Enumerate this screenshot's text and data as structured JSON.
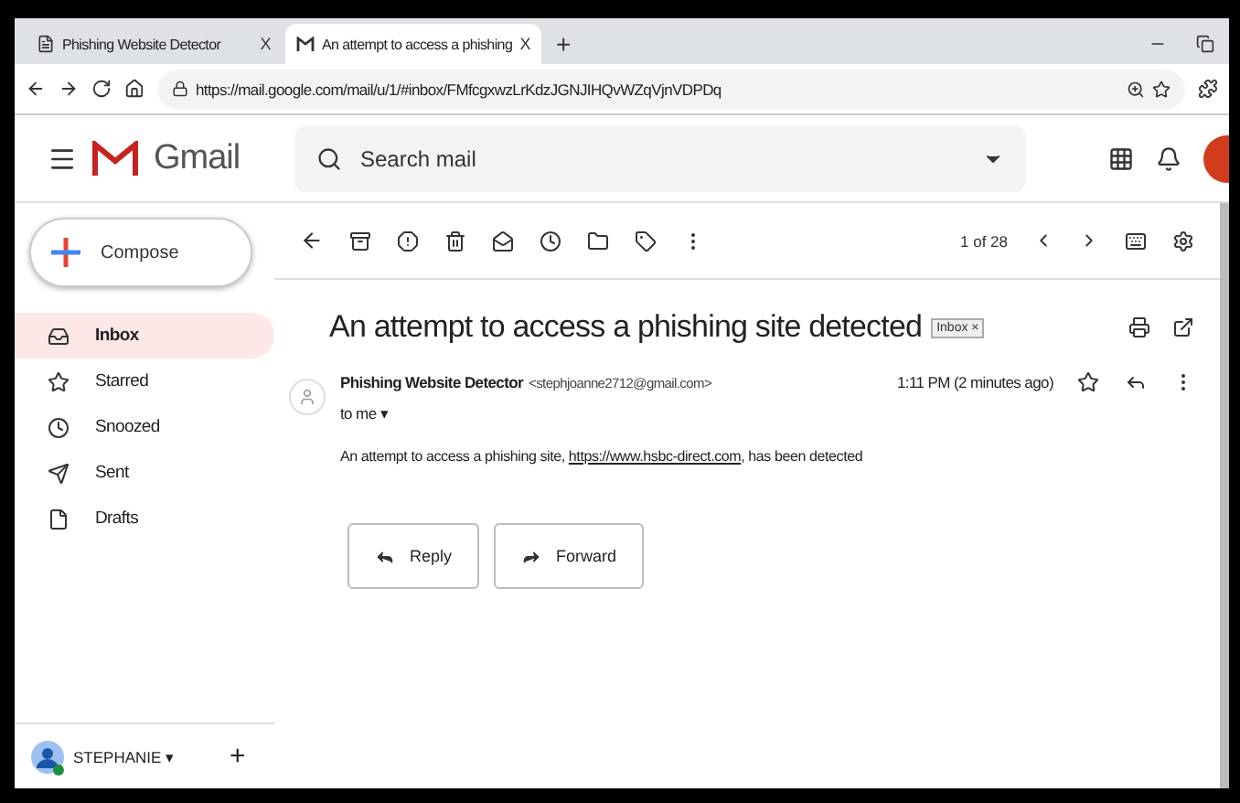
{
  "browser": {
    "tabs": [
      {
        "title": "Phishing Website Detector",
        "close": "X",
        "selected": false,
        "kind": "page"
      },
      {
        "title": "An attempt to access a phishing",
        "close": "X",
        "selected": true,
        "kind": "mail"
      }
    ],
    "new_tab": "+",
    "url": "https://mail.google.com/mail/u/1/#inbox/FMfcgxwzLrKdzJGNJIHQvWZqVjnVDPDq"
  },
  "header": {
    "product": "Gmail",
    "search": {
      "placeholder": "Search mail"
    }
  },
  "sidebar": {
    "compose": "Compose",
    "items": [
      {
        "label": "Inbox",
        "kind": "inbox",
        "selected": true
      },
      {
        "label": "Starred",
        "kind": "star",
        "selected": false
      },
      {
        "label": "Snoozed",
        "kind": "clock",
        "selected": false
      },
      {
        "label": "Sent",
        "kind": "send",
        "selected": false
      },
      {
        "label": "Drafts",
        "kind": "file",
        "selected": false
      }
    ],
    "account": "STEPHANIE ▾",
    "add": "+"
  },
  "toolbar": {
    "pager": "1 of 28"
  },
  "message": {
    "subject": "An attempt to access a phishing site detected",
    "label": "Inbox",
    "label_close": "×",
    "sender": "Phishing Website Detector",
    "address": "<stephjoanne2712@gmail.com>",
    "time": "1:11 PM (2 minutes ago)",
    "to": "to me ▾",
    "body": "An attempt to access a phishing site, ",
    "link": "https://www.hsbc-direct.com",
    "body_end": ", has been detected",
    "actions": [
      {
        "label": "Reply",
        "kind": "reply"
      },
      {
        "label": "Forward",
        "kind": "forward"
      }
    ]
  }
}
